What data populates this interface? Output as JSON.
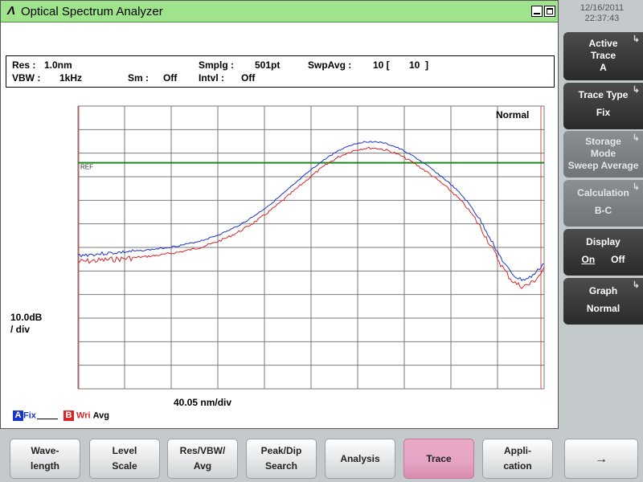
{
  "window": {
    "logo": "Λ",
    "title": "Optical Spectrum Analyzer"
  },
  "clock": {
    "date": "12/16/2011",
    "time": "22:37:43"
  },
  "params": {
    "res_label": "Res :",
    "res_value": "1.0nm",
    "vbw_label": "VBW :",
    "vbw_value": "1kHz",
    "sm_label": "Sm :",
    "sm_value": "Off",
    "smplg_label": "Smplg :",
    "smplg_value": "501pt",
    "intvl_label": "Intvl :",
    "intvl_value": "Off",
    "swpavg_label": "SwpAvg :",
    "swpavg_value": "10 [",
    "swpavg_count": "10",
    "swpavg_close": "]"
  },
  "graph": {
    "mode_label": "Normal",
    "ref_label": "REF",
    "y_scale_line1": "10.0dB",
    "y_scale_line2": "/ div",
    "x_scale": "40.05 nm/div",
    "colors": {
      "trace_a": "#1a35c8",
      "trace_b": "#d6262a",
      "ref_line": "#1a8a1a",
      "grid": "#7a7a7a",
      "edge": "#d05050"
    }
  },
  "traces": {
    "a_letter": "A",
    "a_mode": "Fix",
    "b_letter": "B",
    "b_mode": "Wri",
    "b_extra": "Avg"
  },
  "softkeys": {
    "active_trace": {
      "line1": "Active",
      "line2": "Trace",
      "line3": "A"
    },
    "trace_type": {
      "line1": "Trace Type",
      "line2": "Fix"
    },
    "storage_mode": {
      "line1": "Storage",
      "line2": "Mode",
      "line3": "Sweep Average"
    },
    "calculation": {
      "line1": "Calculation",
      "line2": "B-C"
    },
    "display": {
      "line1": "Display",
      "on": "On",
      "off": "Off"
    },
    "graph": {
      "line1": "Graph",
      "line2": "Normal"
    }
  },
  "bottom_keys": {
    "wavelength": {
      "line1": "Wave-",
      "line2": "length"
    },
    "level_scale": {
      "line1": "Level",
      "line2": "Scale"
    },
    "res_vbw_avg": {
      "line1": "Res/VBW/",
      "line2": "Avg"
    },
    "peak_dip": {
      "line1": "Peak/Dip",
      "line2": "Search"
    },
    "analysis": {
      "line1": "Analysis"
    },
    "trace": {
      "line1": "Trace"
    },
    "application": {
      "line1": "Appli-",
      "line2": "cation"
    },
    "next": {
      "line1": "→"
    }
  }
}
